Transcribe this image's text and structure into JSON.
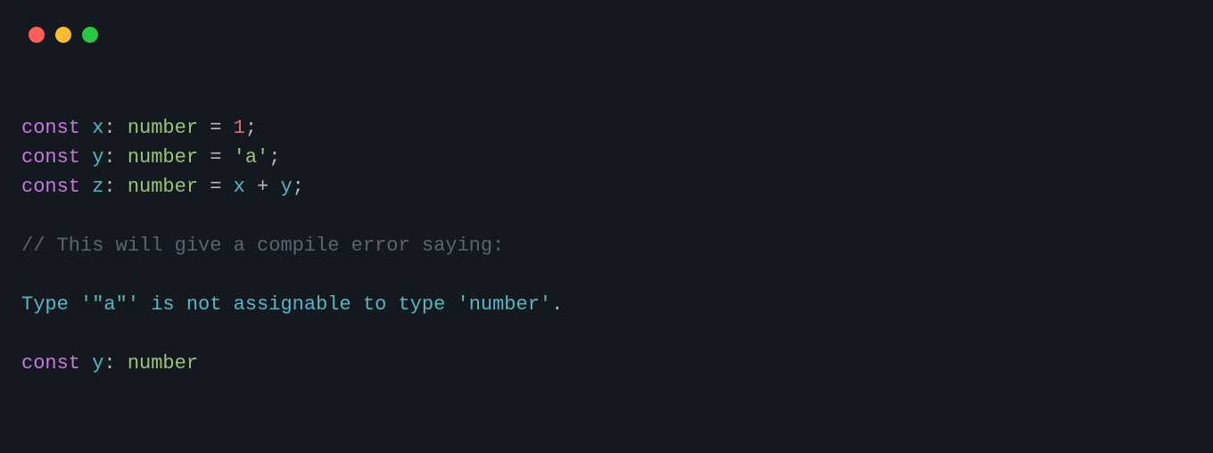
{
  "lines": {
    "l1": {
      "kw": "const",
      "sp1": " ",
      "var": "x",
      "colon": ": ",
      "type": "number",
      "eq": " = ",
      "val": "1",
      "semi": ";"
    },
    "l2": {
      "kw": "const",
      "sp1": " ",
      "var": "y",
      "colon": ": ",
      "type": "number",
      "eq": " = ",
      "val": "'a'",
      "semi": ";"
    },
    "l3": {
      "kw": "const",
      "sp1": " ",
      "var": "z",
      "colon": ": ",
      "type": "number",
      "eq": " = ",
      "lhs": "x",
      "op": " + ",
      "rhs": "y",
      "semi": ";"
    },
    "blank": "",
    "comment": "// This will give a compile error saying:",
    "err": {
      "a": "Type ",
      "b": "'\"a\"'",
      "c": " is not assignable to type ",
      "d": "'number'",
      "dot": "."
    },
    "l9": {
      "kw": "const",
      "sp1": " ",
      "var": "y",
      "colon": ": ",
      "type": "number"
    }
  }
}
